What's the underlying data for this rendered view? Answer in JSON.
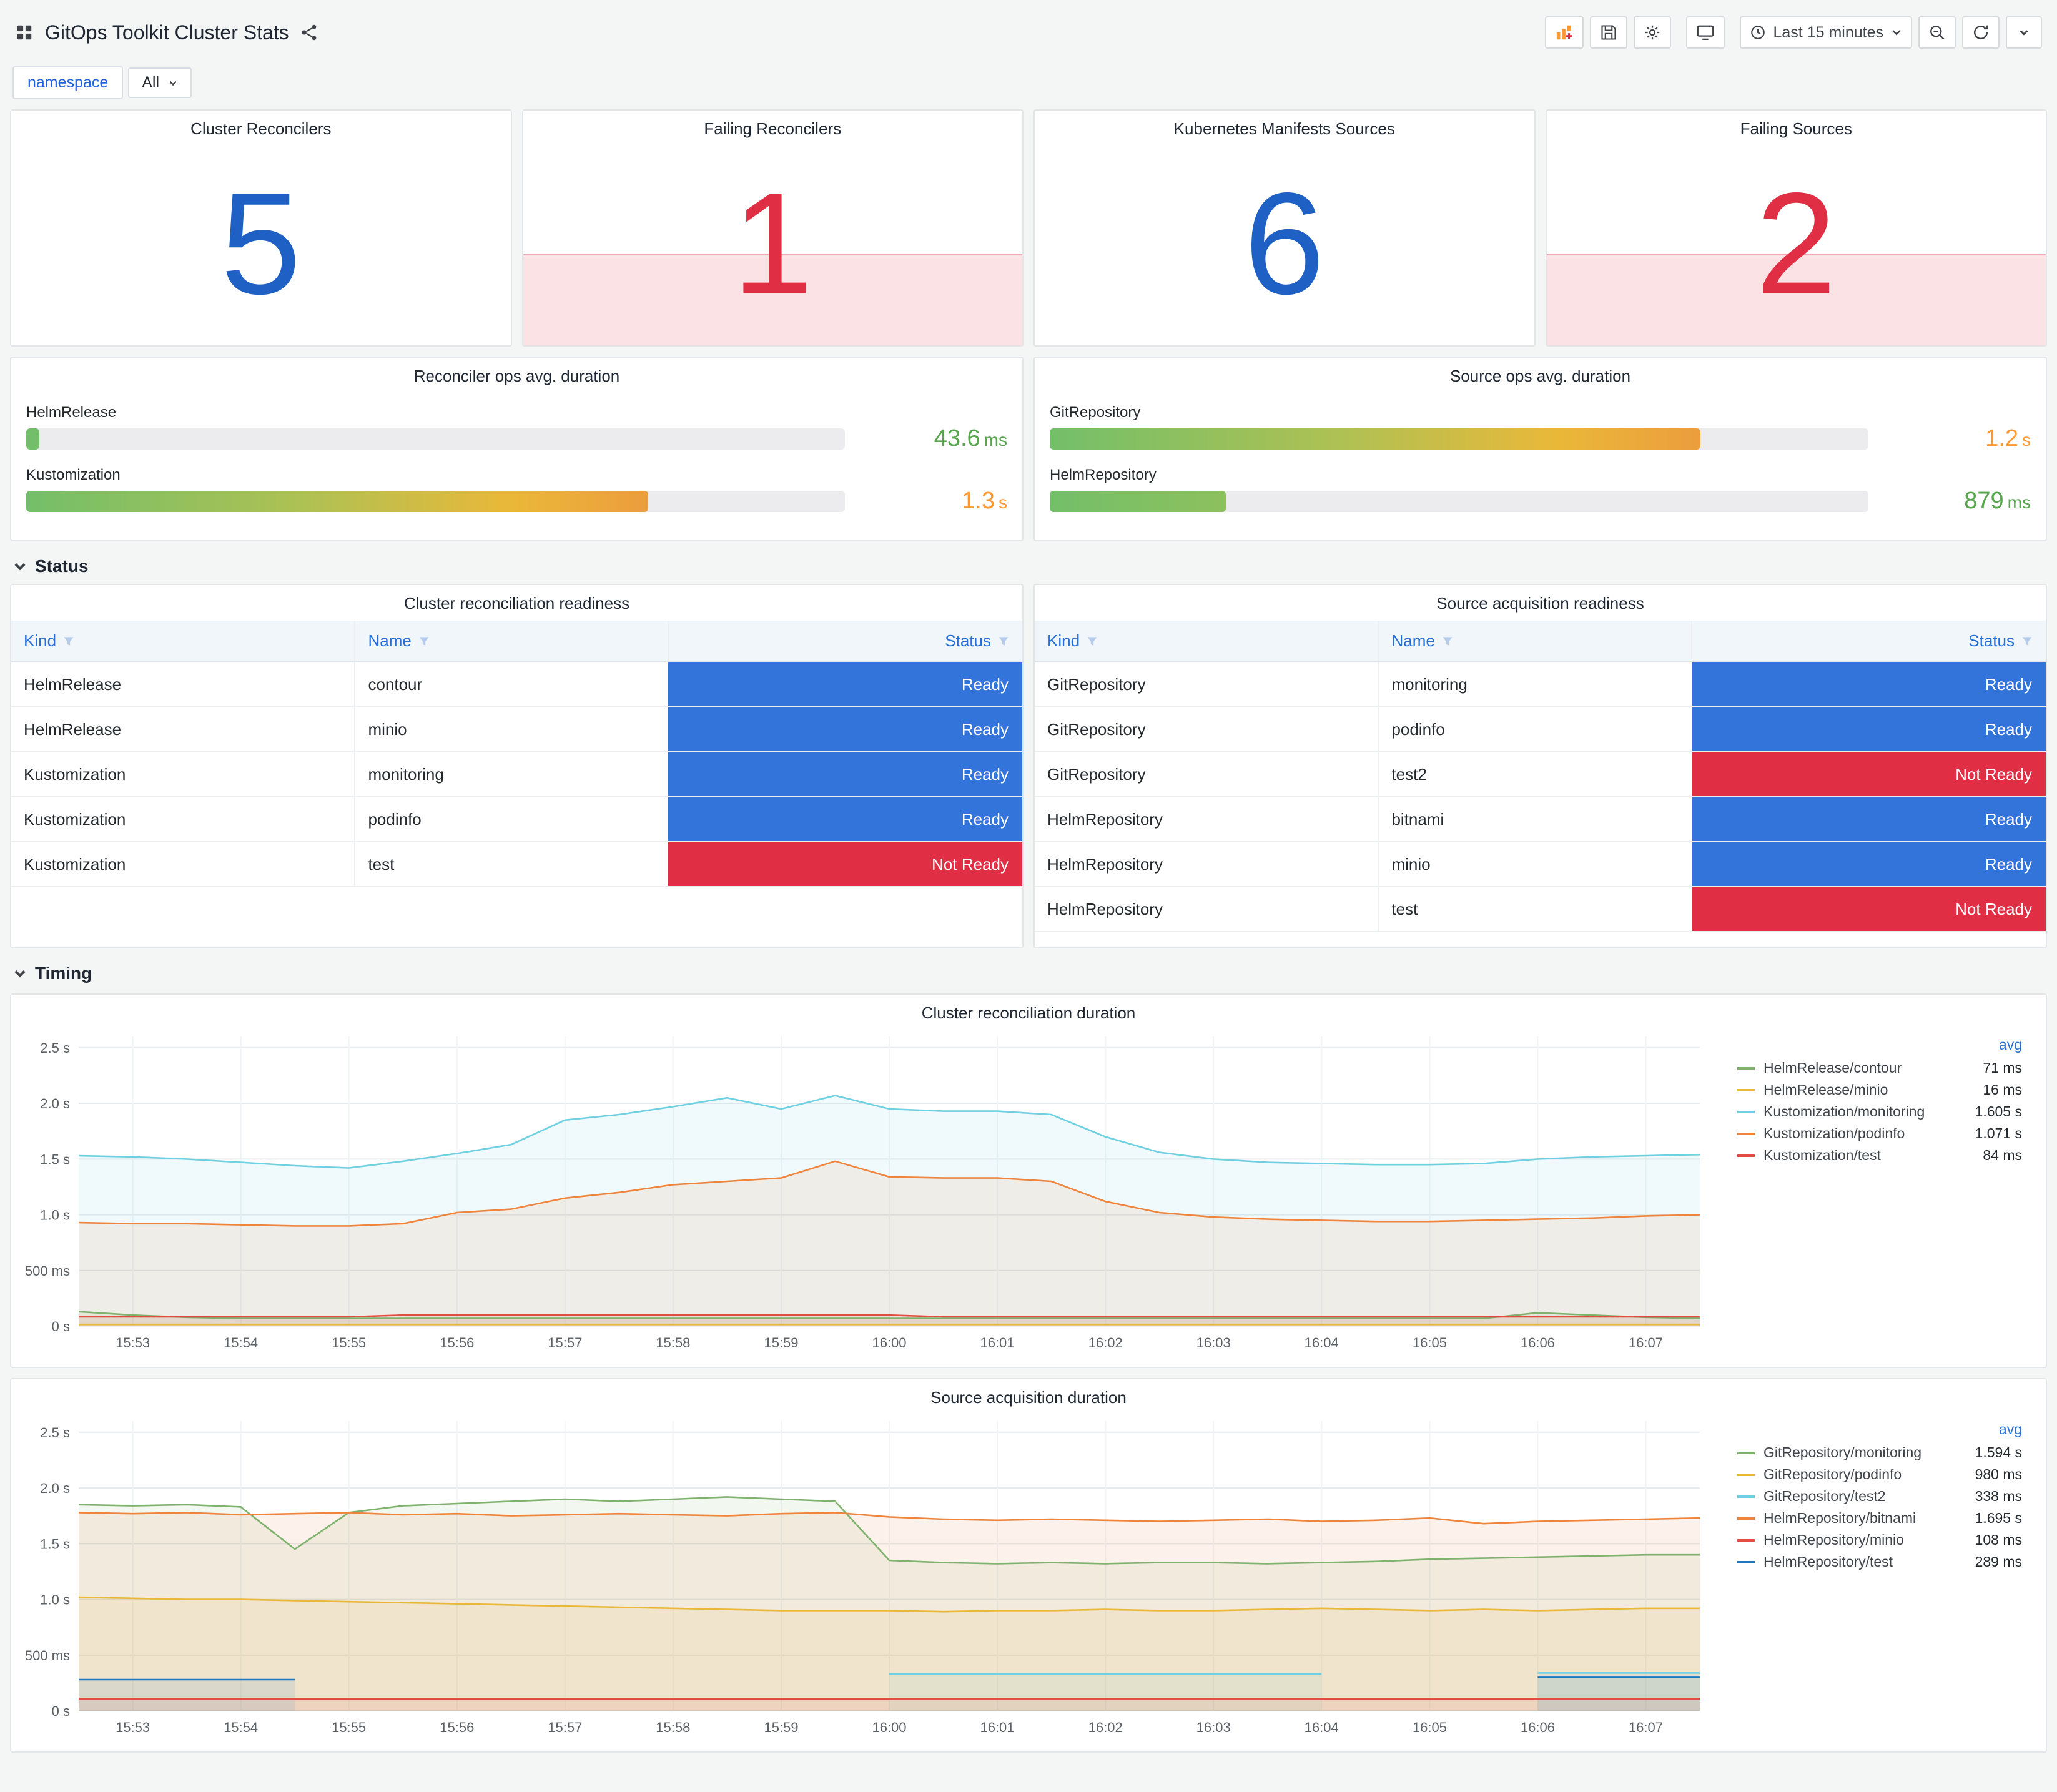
{
  "header": {
    "title": "GitOps Toolkit Cluster Stats",
    "time_range": "Last 15 minutes"
  },
  "variables": [
    {
      "label": "namespace",
      "value": "All"
    }
  ],
  "stat_panels": [
    {
      "title": "Cluster Reconcilers",
      "value": "5",
      "color": "#1F60C4",
      "alert": false
    },
    {
      "title": "Failing Reconcilers",
      "value": "1",
      "color": "#E02F44",
      "alert": true
    },
    {
      "title": "Kubernetes Manifests Sources",
      "value": "6",
      "color": "#1F60C4",
      "alert": false
    },
    {
      "title": "Failing Sources",
      "value": "2",
      "color": "#E02F44",
      "alert": true
    }
  ],
  "gauge_panels": [
    {
      "title": "Reconciler ops avg. duration",
      "bars": [
        {
          "label": "HelmRelease",
          "value": "43.6",
          "unit": "ms",
          "percent": 1.6,
          "fill": "#73BF69",
          "value_color": "#56A64B"
        },
        {
          "label": "Kustomization",
          "value": "1.3",
          "unit": "s",
          "percent": 76,
          "fill": "linear-gradient(90deg,#73BF69,#AFC153 45%,#EAB839 78%,#EC9D3D)",
          "value_color": "#FF9830"
        }
      ]
    },
    {
      "title": "Source ops avg. duration",
      "bars": [
        {
          "label": "GitRepository",
          "value": "1.2",
          "unit": "s",
          "percent": 79.5,
          "fill": "linear-gradient(90deg,#73BF69,#AFC153 45%,#EAB839 78%,#EC9D3D)",
          "value_color": "#FF9830"
        },
        {
          "label": "HelmRepository",
          "value": "879",
          "unit": "ms",
          "percent": 21.5,
          "fill": "linear-gradient(90deg,#73BF69,#8DC05E)",
          "value_color": "#56A64B"
        }
      ]
    }
  ],
  "sections": [
    {
      "label": "Status"
    },
    {
      "label": "Timing"
    }
  ],
  "status_colors": {
    "Ready": "#3274D9",
    "Not Ready": "#E02F44"
  },
  "tables": [
    {
      "title": "Cluster reconciliation readiness",
      "columns": [
        "Kind",
        "Name",
        "Status"
      ],
      "rows": [
        [
          "HelmRelease",
          "contour",
          "Ready"
        ],
        [
          "HelmRelease",
          "minio",
          "Ready"
        ],
        [
          "Kustomization",
          "monitoring",
          "Ready"
        ],
        [
          "Kustomization",
          "podinfo",
          "Ready"
        ],
        [
          "Kustomization",
          "test",
          "Not Ready"
        ]
      ]
    },
    {
      "title": "Source acquisition readiness",
      "columns": [
        "Kind",
        "Name",
        "Status"
      ],
      "rows": [
        [
          "GitRepository",
          "monitoring",
          "Ready"
        ],
        [
          "GitRepository",
          "podinfo",
          "Ready"
        ],
        [
          "GitRepository",
          "test2",
          "Not Ready"
        ],
        [
          "HelmRepository",
          "bitnami",
          "Ready"
        ],
        [
          "HelmRepository",
          "minio",
          "Ready"
        ],
        [
          "HelmRepository",
          "test",
          "Not Ready"
        ]
      ]
    }
  ],
  "chart_data": [
    {
      "type": "line",
      "title": "Cluster reconciliation duration",
      "legend_header": "avg",
      "legend_position": "right",
      "grid": true,
      "ylim": [
        0,
        2.6
      ],
      "yticks": [
        {
          "v": 0,
          "label": "0 s"
        },
        {
          "v": 0.5,
          "label": "500 ms"
        },
        {
          "v": 1,
          "label": "1.0 s"
        },
        {
          "v": 1.5,
          "label": "1.5 s"
        },
        {
          "v": 2,
          "label": "2.0 s"
        },
        {
          "v": 2.5,
          "label": "2.5 s"
        }
      ],
      "x_ticks": [
        "15:53",
        "15:54",
        "15:55",
        "15:56",
        "15:57",
        "15:58",
        "15:59",
        "16:00",
        "16:01",
        "16:02",
        "16:03",
        "16:04",
        "16:05",
        "16:06",
        "16:07"
      ],
      "x_step_minutes": 0.5,
      "series": [
        {
          "name": "HelmRelease/contour",
          "avg": "71 ms",
          "color": "#7EB26D",
          "values": [
            0.13,
            0.1,
            0.08,
            0.07,
            0.07,
            0.07,
            0.07,
            0.07,
            0.07,
            0.07,
            0.07,
            0.07,
            0.07,
            0.07,
            0.07,
            0.07,
            0.07,
            0.07,
            0.07,
            0.07,
            0.07,
            0.07,
            0.07,
            0.07,
            0.07,
            0.07,
            0.07,
            0.12,
            0.1,
            0.08,
            0.07
          ]
        },
        {
          "name": "HelmRelease/minio",
          "avg": "16 ms",
          "color": "#EAB839",
          "values": [
            0.016,
            0.016,
            0.016,
            0.016,
            0.016,
            0.016,
            0.016,
            0.016,
            0.016,
            0.016,
            0.016,
            0.016,
            0.016,
            0.016,
            0.016,
            0.016,
            0.016,
            0.016,
            0.016,
            0.016,
            0.016,
            0.016,
            0.016,
            0.016,
            0.016,
            0.016,
            0.016,
            0.016,
            0.016,
            0.016,
            0.016
          ]
        },
        {
          "name": "Kustomization/monitoring",
          "avg": "1.605 s",
          "color": "#6ED0E0",
          "values": [
            1.53,
            1.52,
            1.5,
            1.47,
            1.44,
            1.42,
            1.48,
            1.55,
            1.63,
            1.85,
            1.9,
            1.97,
            2.05,
            1.95,
            2.07,
            1.95,
            1.93,
            1.93,
            1.9,
            1.7,
            1.56,
            1.5,
            1.47,
            1.46,
            1.45,
            1.45,
            1.46,
            1.5,
            1.52,
            1.53,
            1.54
          ]
        },
        {
          "name": "Kustomization/podinfo",
          "avg": "1.071 s",
          "color": "#EF843C",
          "values": [
            0.93,
            0.92,
            0.92,
            0.91,
            0.9,
            0.9,
            0.92,
            1.02,
            1.05,
            1.15,
            1.2,
            1.27,
            1.3,
            1.33,
            1.48,
            1.34,
            1.33,
            1.33,
            1.3,
            1.12,
            1.02,
            0.98,
            0.96,
            0.95,
            0.94,
            0.94,
            0.95,
            0.96,
            0.97,
            0.99,
            1.0
          ]
        },
        {
          "name": "Kustomization/test",
          "avg": "84 ms",
          "color": "#E24D42",
          "values": [
            0.084,
            0.084,
            0.084,
            0.084,
            0.084,
            0.084,
            0.1,
            0.1,
            0.1,
            0.1,
            0.1,
            0.1,
            0.1,
            0.1,
            0.1,
            0.1,
            0.084,
            0.084,
            0.084,
            0.084,
            0.084,
            0.084,
            0.084,
            0.084,
            0.084,
            0.084,
            0.084,
            0.084,
            0.084,
            0.084,
            0.084
          ]
        }
      ]
    },
    {
      "type": "line",
      "title": "Source acquisition duration",
      "legend_header": "avg",
      "legend_position": "right",
      "grid": true,
      "ylim": [
        0,
        2.6
      ],
      "yticks": [
        {
          "v": 0,
          "label": "0 s"
        },
        {
          "v": 0.5,
          "label": "500 ms"
        },
        {
          "v": 1,
          "label": "1.0 s"
        },
        {
          "v": 1.5,
          "label": "1.5 s"
        },
        {
          "v": 2,
          "label": "2.0 s"
        },
        {
          "v": 2.5,
          "label": "2.5 s"
        }
      ],
      "x_ticks": [
        "15:53",
        "15:54",
        "15:55",
        "15:56",
        "15:57",
        "15:58",
        "15:59",
        "16:00",
        "16:01",
        "16:02",
        "16:03",
        "16:04",
        "16:05",
        "16:06",
        "16:07"
      ],
      "x_step_minutes": 0.5,
      "series": [
        {
          "name": "GitRepository/monitoring",
          "avg": "1.594 s",
          "color": "#7EB26D",
          "values": [
            1.85,
            1.84,
            1.85,
            1.83,
            1.45,
            1.78,
            1.84,
            1.86,
            1.88,
            1.9,
            1.88,
            1.9,
            1.92,
            1.9,
            1.88,
            1.35,
            1.33,
            1.32,
            1.33,
            1.32,
            1.33,
            1.33,
            1.32,
            1.33,
            1.34,
            1.36,
            1.37,
            1.38,
            1.39,
            1.4,
            1.4
          ]
        },
        {
          "name": "GitRepository/podinfo",
          "avg": "980 ms",
          "color": "#EAB839",
          "values": [
            1.02,
            1.01,
            1.0,
            1.0,
            0.99,
            0.98,
            0.97,
            0.96,
            0.95,
            0.94,
            0.93,
            0.92,
            0.91,
            0.9,
            0.9,
            0.9,
            0.89,
            0.9,
            0.9,
            0.91,
            0.9,
            0.9,
            0.91,
            0.92,
            0.91,
            0.9,
            0.91,
            0.9,
            0.91,
            0.92,
            0.92
          ]
        },
        {
          "name": "GitRepository/test2",
          "avg": "338 ms",
          "color": "#6ED0E0",
          "values": [
            null,
            null,
            null,
            null,
            null,
            null,
            null,
            null,
            null,
            null,
            null,
            null,
            null,
            null,
            null,
            0.33,
            0.33,
            0.33,
            0.33,
            0.33,
            0.33,
            0.33,
            0.33,
            0.33,
            null,
            null,
            null,
            0.34,
            0.34,
            0.34,
            0.34
          ]
        },
        {
          "name": "HelmRepository/bitnami",
          "avg": "1.695 s",
          "color": "#EF843C",
          "values": [
            1.78,
            1.77,
            1.78,
            1.76,
            1.77,
            1.78,
            1.76,
            1.77,
            1.75,
            1.76,
            1.77,
            1.76,
            1.75,
            1.77,
            1.78,
            1.74,
            1.72,
            1.71,
            1.72,
            1.71,
            1.7,
            1.71,
            1.72,
            1.7,
            1.71,
            1.73,
            1.68,
            1.7,
            1.71,
            1.72,
            1.73
          ]
        },
        {
          "name": "HelmRepository/minio",
          "avg": "108 ms",
          "color": "#E24D42",
          "values": [
            0.108,
            0.108,
            0.108,
            0.108,
            0.108,
            0.108,
            0.108,
            0.108,
            0.108,
            0.108,
            0.108,
            0.108,
            0.108,
            0.108,
            0.108,
            0.108,
            0.108,
            0.108,
            0.108,
            0.108,
            0.108,
            0.108,
            0.108,
            0.108,
            0.108,
            0.108,
            0.108,
            0.108,
            0.108,
            0.108,
            0.108
          ]
        },
        {
          "name": "HelmRepository/test",
          "avg": "289 ms",
          "color": "#1F78C1",
          "values": [
            0.28,
            0.28,
            0.28,
            0.28,
            0.28,
            null,
            null,
            null,
            null,
            null,
            null,
            null,
            null,
            null,
            null,
            null,
            null,
            null,
            null,
            null,
            null,
            null,
            null,
            null,
            null,
            null,
            null,
            0.3,
            0.3,
            0.3,
            0.3
          ]
        }
      ]
    }
  ]
}
